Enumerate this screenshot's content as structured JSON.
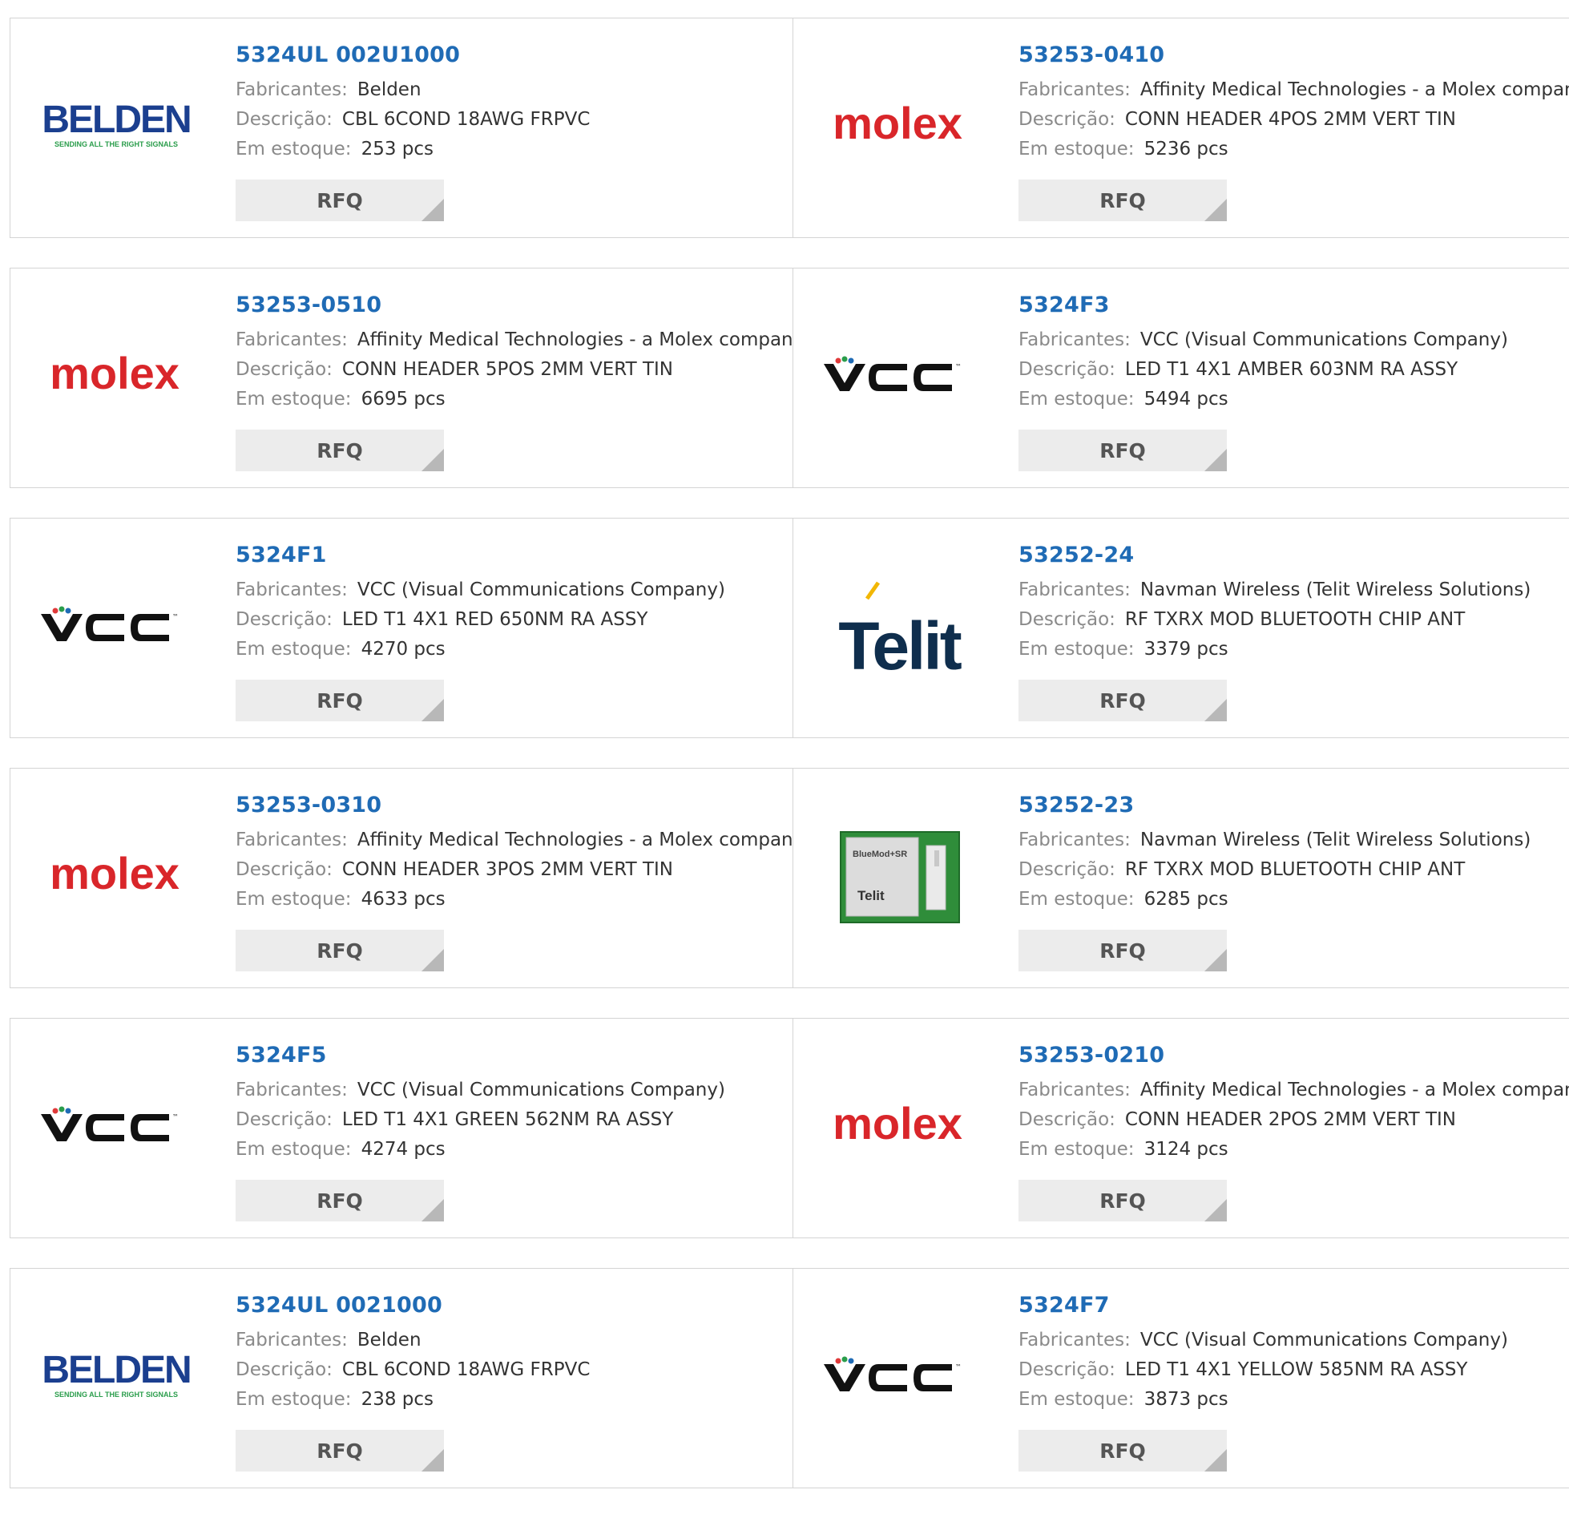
{
  "labels": {
    "manufacturer": "Fabricantes:",
    "description": "Descrição:",
    "stock": "Em estoque:",
    "rfq": "RFQ"
  },
  "brand_text": {
    "belden": "BELDEN",
    "belden_tagline": "SENDING ALL THE RIGHT SIGNALS",
    "molex": "molex",
    "vcc": "VCC",
    "telit": "Telit",
    "bluemod": "BlueMod+SR"
  },
  "products": [
    {
      "part": "5324UL 002U1000",
      "manufacturer": "Belden",
      "description": "CBL 6COND 18AWG FRPVC",
      "stock": "253 pcs",
      "logo": "belden-logo"
    },
    {
      "part": "53253-0410",
      "manufacturer": "Affinity Medical Technologies - a Molex company",
      "description": "CONN HEADER 4POS 2MM VERT TIN",
      "stock": "5236 pcs",
      "logo": "molex-logo"
    },
    {
      "part": "53253-0510",
      "manufacturer": "Affinity Medical Technologies - a Molex company",
      "description": "CONN HEADER 5POS 2MM VERT TIN",
      "stock": "6695 pcs",
      "logo": "molex-logo"
    },
    {
      "part": "5324F3",
      "manufacturer": "VCC (Visual Communications Company)",
      "description": "LED T1 4X1 AMBER 603NM RA ASSY",
      "stock": "5494 pcs",
      "logo": "vcc-logo"
    },
    {
      "part": "5324F1",
      "manufacturer": "VCC (Visual Communications Company)",
      "description": "LED T1 4X1 RED 650NM RA ASSY",
      "stock": "4270 pcs",
      "logo": "vcc-logo"
    },
    {
      "part": "53252-24",
      "manufacturer": "Navman Wireless (Telit Wireless Solutions)",
      "description": "RF TXRX MOD BLUETOOTH CHIP ANT",
      "stock": "3379 pcs",
      "logo": "telit-logo"
    },
    {
      "part": "53253-0310",
      "manufacturer": "Affinity Medical Technologies - a Molex company",
      "description": "CONN HEADER 3POS 2MM VERT TIN",
      "stock": "4633 pcs",
      "logo": "molex-logo"
    },
    {
      "part": "53252-23",
      "manufacturer": "Navman Wireless (Telit Wireless Solutions)",
      "description": "RF TXRX MOD BLUETOOTH CHIP ANT",
      "stock": "6285 pcs",
      "logo": "bluemod-module-image"
    },
    {
      "part": "5324F5",
      "manufacturer": "VCC (Visual Communications Company)",
      "description": "LED T1 4X1 GREEN 562NM RA ASSY",
      "stock": "4274 pcs",
      "logo": "vcc-logo"
    },
    {
      "part": "53253-0210",
      "manufacturer": "Affinity Medical Technologies - a Molex company",
      "description": "CONN HEADER 2POS 2MM VERT TIN",
      "stock": "3124 pcs",
      "logo": "molex-logo"
    },
    {
      "part": "5324UL 0021000",
      "manufacturer": "Belden",
      "description": "CBL 6COND 18AWG FRPVC",
      "stock": "238 pcs",
      "logo": "belden-logo"
    },
    {
      "part": "5324F7",
      "manufacturer": "VCC (Visual Communications Company)",
      "description": "LED T1 4X1 YELLOW 585NM RA ASSY",
      "stock": "3873 pcs",
      "logo": "vcc-logo"
    }
  ]
}
